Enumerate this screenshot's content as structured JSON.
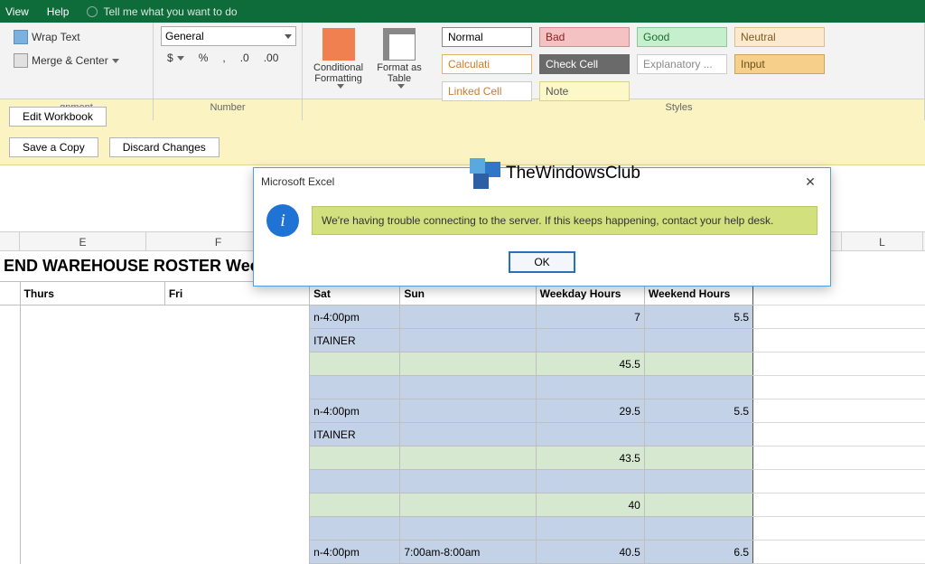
{
  "menu": {
    "view": "View",
    "help": "Help",
    "tell": "Tell me what you want to do"
  },
  "ribbon": {
    "alignment": {
      "wrap": "Wrap Text",
      "merge": "Merge & Center",
      "label": "gnment"
    },
    "number": {
      "format": "General",
      "sym1": "$",
      "sym2": "%",
      "sym3": ",",
      "dec1": ".0",
      "dec2": ".00",
      "label": "Number"
    },
    "cond": "Conditional Formatting",
    "fmt_table": "Format as Table",
    "styles_label": "Styles",
    "styles": [
      {
        "t": "Normal",
        "bg": "#ffffff",
        "fg": "#000",
        "bd": "#888"
      },
      {
        "t": "Bad",
        "bg": "#f4c2c2",
        "fg": "#8a1f1f",
        "bd": "#d28e8e"
      },
      {
        "t": "Good",
        "bg": "#c6efce",
        "fg": "#1e6b30",
        "bd": "#8cc79a"
      },
      {
        "t": "Neutral",
        "bg": "#fde9cd",
        "fg": "#7a5b1f",
        "bd": "#d9be8e"
      },
      {
        "t": "Calculati",
        "bg": "#fff",
        "fg": "#d07a2a",
        "bd": "#e4b36b"
      },
      {
        "t": "Check Cell",
        "bg": "#6a6a6a",
        "fg": "#fff",
        "bd": "#6a6a6a"
      },
      {
        "t": "Explanatory ...",
        "bg": "#fff",
        "fg": "#8a8a8a",
        "bd": "#ccc"
      },
      {
        "t": "Input",
        "bg": "#f6d08a",
        "fg": "#6a4e16",
        "bd": "#caa557"
      },
      {
        "t": "Linked Cell",
        "bg": "#fff",
        "fg": "#d07a2a",
        "bd": "#ccc"
      },
      {
        "t": "Note",
        "bg": "#fdf8c7",
        "fg": "#555",
        "bd": "#d8d28a"
      }
    ]
  },
  "notice": {
    "edit": "Edit Workbook",
    "save": "Save a Copy",
    "discard": "Discard Changes"
  },
  "cols": [
    "E",
    "F",
    "",
    "",
    "",
    "",
    "",
    "L"
  ],
  "title": "END WAREHOUSE ROSTER Week Ending 24 DECEMBER",
  "hdr": {
    "thurs": "Thurs",
    "fri": "Fri",
    "sat": "Sat",
    "sun": "Sun",
    "wd": "Weekday Hours",
    "we": "Weekend Hours"
  },
  "rows": [
    {
      "cls": "blue",
      "c3": "n-4:00pm",
      "c4": "",
      "c5": "7",
      "c6": "5.5"
    },
    {
      "cls": "blue",
      "c3": "ITAINER",
      "c4": "",
      "c5": "",
      "c6": ""
    },
    {
      "cls": "green",
      "c3": "",
      "c4": "",
      "c5": "45.5",
      "c6": ""
    },
    {
      "cls": "blue",
      "c3": "",
      "c4": "",
      "c5": "",
      "c6": ""
    },
    {
      "cls": "blue",
      "c3": "n-4:00pm",
      "c4": "",
      "c5": "29.5",
      "c6": "5.5"
    },
    {
      "cls": "blue",
      "c3": "ITAINER",
      "c4": "",
      "c5": "",
      "c6": ""
    },
    {
      "cls": "green",
      "c3": "",
      "c4": "",
      "c5": "43.5",
      "c6": ""
    },
    {
      "cls": "blue",
      "c3": "",
      "c4": "",
      "c5": "",
      "c6": ""
    },
    {
      "cls": "green",
      "c3": "",
      "c4": "",
      "c5": "40",
      "c6": ""
    },
    {
      "cls": "blue",
      "c3": "",
      "c4": "",
      "c5": "",
      "c6": ""
    },
    {
      "cls": "blue",
      "c3": "n-4:00pm",
      "c4": "7:00am-8:00am",
      "c5": "40.5",
      "c6": "6.5"
    }
  ],
  "dialog": {
    "title": "Microsoft Excel",
    "msg": "We're having trouble connecting to the server. If this keeps happening, contact your help desk.",
    "ok": "OK"
  },
  "watermark": "TheWindowsClub"
}
